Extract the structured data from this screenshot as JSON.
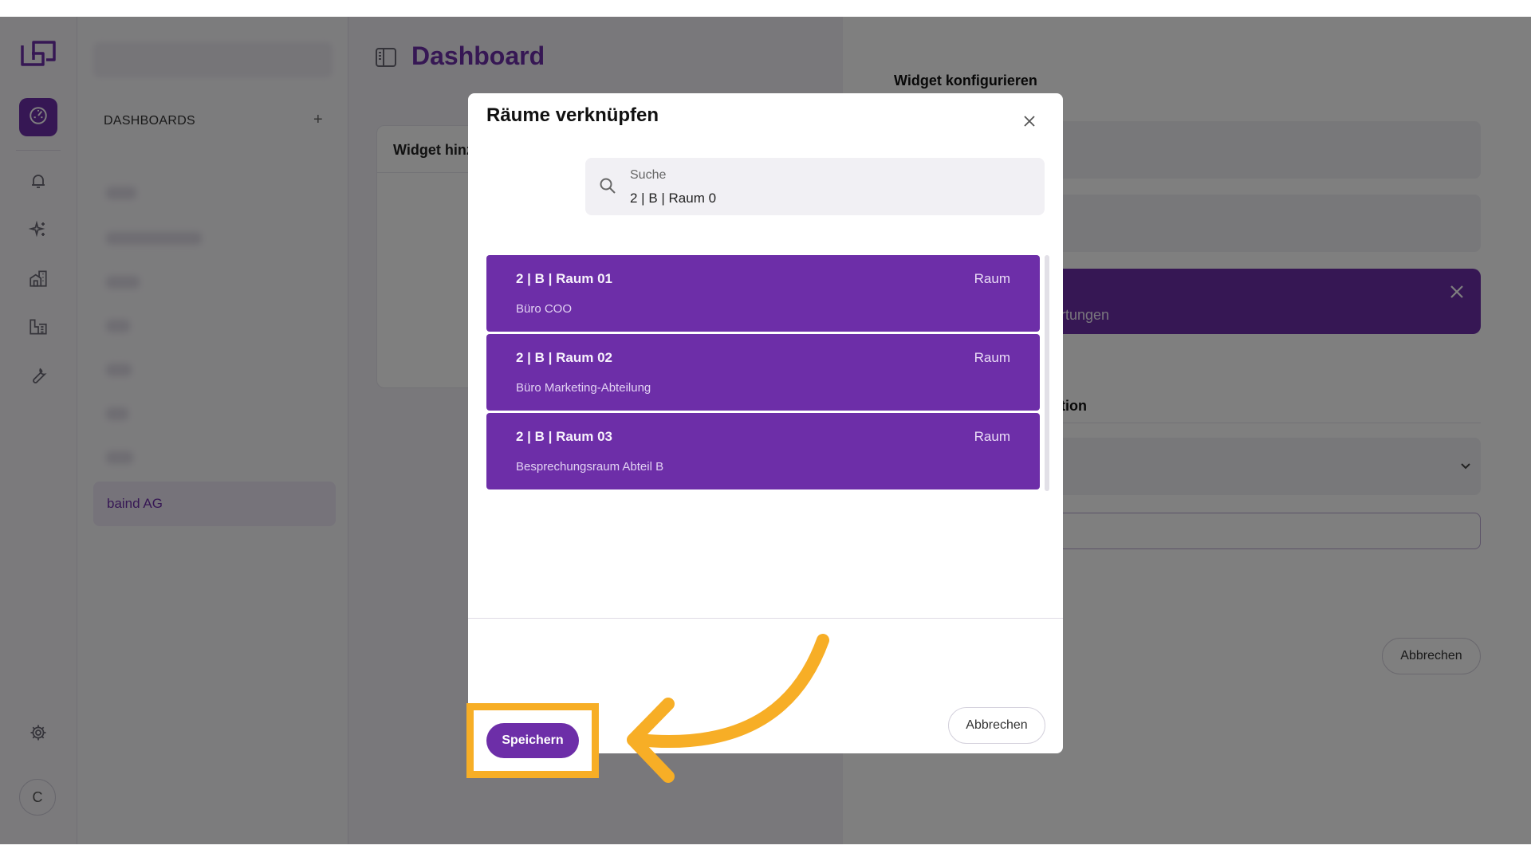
{
  "sidebar": {
    "heading": "DASHBOARDS",
    "add_icon": "+",
    "company_name": "baind AG"
  },
  "main": {
    "title": "Dashboard",
    "card_title": "Widget hinz"
  },
  "drawer": {
    "title": "Widget konfigurieren",
    "chip_text": "rtungen",
    "section_label": "tion",
    "cancel_label": "Abbrechen"
  },
  "modal": {
    "title": "Räume verknüpfen",
    "search": {
      "label": "Suche",
      "value": "2 | B | Raum 0"
    },
    "rooms": [
      {
        "name": "2 | B | Raum 01",
        "type": "Raum",
        "description": "Büro COO"
      },
      {
        "name": "2 | B | Raum 02",
        "type": "Raum",
        "description": "Büro Marketing-Abteilung"
      },
      {
        "name": "2 | B | Raum 03",
        "type": "Raum",
        "description": "Besprechungsraum Abteil B"
      }
    ],
    "save_label": "Speichern",
    "cancel_label": "Abbrechen"
  },
  "user": {
    "avatar_initial": "C"
  },
  "colors": {
    "brand": "#6d2ea8",
    "highlight": "#f7ae26"
  },
  "icons": [
    "logo-icon",
    "dashboard-icon",
    "bell-icon",
    "sparkles-icon",
    "buildings-icon",
    "floorplan-icon",
    "wrench-icon",
    "settings-icon",
    "sidebar-panel-icon",
    "close-icon",
    "search-icon",
    "chevron-down-icon"
  ]
}
